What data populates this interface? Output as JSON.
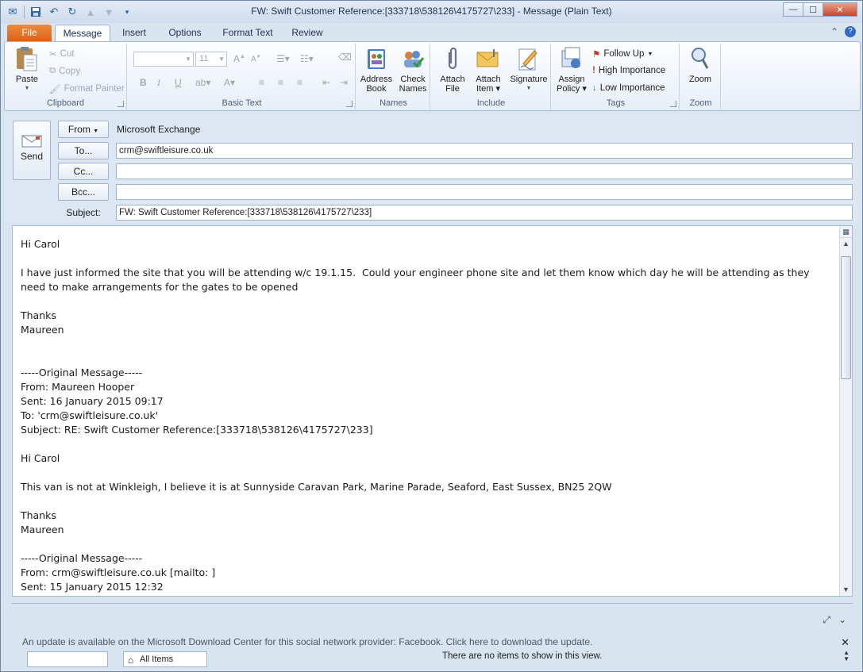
{
  "window": {
    "title": "FW: Swift Customer Reference:[333718\\538126\\4175727\\233]  -  Message (Plain Text)"
  },
  "tabs": [
    "File",
    "Message",
    "Insert",
    "Options",
    "Format Text",
    "Review"
  ],
  "ribbon": {
    "clipboard": {
      "paste": "Paste",
      "cut": "Cut",
      "copy": "Copy",
      "format_painter": "Format Painter",
      "label": "Clipboard"
    },
    "basic_text": {
      "font_size": "11",
      "label": "Basic Text"
    },
    "names": {
      "address_book_1": "Address",
      "address_book_2": "Book",
      "check_names_1": "Check",
      "check_names_2": "Names",
      "label": "Names"
    },
    "include": {
      "attach_file_1": "Attach",
      "attach_file_2": "File",
      "attach_item_1": "Attach",
      "attach_item_2": "Item",
      "signature": "Signature",
      "label": "Include"
    },
    "tags": {
      "assign_policy_1": "Assign",
      "assign_policy_2": "Policy",
      "follow_up": "Follow Up",
      "high_importance": "High Importance",
      "low_importance": "Low Importance",
      "label": "Tags"
    },
    "zoom": {
      "zoom": "Zoom",
      "label": "Zoom"
    }
  },
  "header": {
    "send": "Send",
    "from_button": "From",
    "from_value": "Microsoft Exchange",
    "to_button": "To...",
    "to_value": "crm@swiftleisure.co.uk",
    "cc_button": "Cc...",
    "cc_value": "",
    "bcc_button": "Bcc...",
    "bcc_value": "",
    "subject_label": "Subject:",
    "subject_value": "FW: Swift Customer Reference:[333718\\538126\\4175727\\233]"
  },
  "body_lines": [
    "Hi Carol",
    "",
    "I have just informed the site that you will be attending w/c 19.1.15.  Could your engineer phone site and let them know which day he will be attending as they need to make arrangements for the gates to be opened",
    "",
    "Thanks",
    "Maureen",
    "",
    "",
    "-----Original Message-----",
    "From: Maureen Hooper",
    "Sent: 16 January 2015 09:17",
    "To: 'crm@swiftleisure.co.uk'",
    "Subject: RE: Swift Customer Reference:[333718\\538126\\4175727\\233]",
    "",
    "Hi Carol",
    "",
    "This van is not at Winkleigh, I believe it is at Sunnyside Caravan Park, Marine Parade, Seaford, East Sussex, BN25 2QW",
    "",
    "Thanks",
    "Maureen",
    "",
    "-----Original Message-----",
    "From: crm@swiftleisure.co.uk [mailto: ]",
    "Sent: 15 January 2015 12:32"
  ],
  "people_pane": {
    "update_notice": "An update is available on the Microsoft Download Center for this social network provider: Facebook. Click here to download the update.",
    "filter": "All Items",
    "empty": "There are no items to show in this view."
  },
  "colors": {
    "file_tab": "#e06d22",
    "ribbon_bg": "#e6eef8",
    "frame": "#d9e4f1"
  }
}
